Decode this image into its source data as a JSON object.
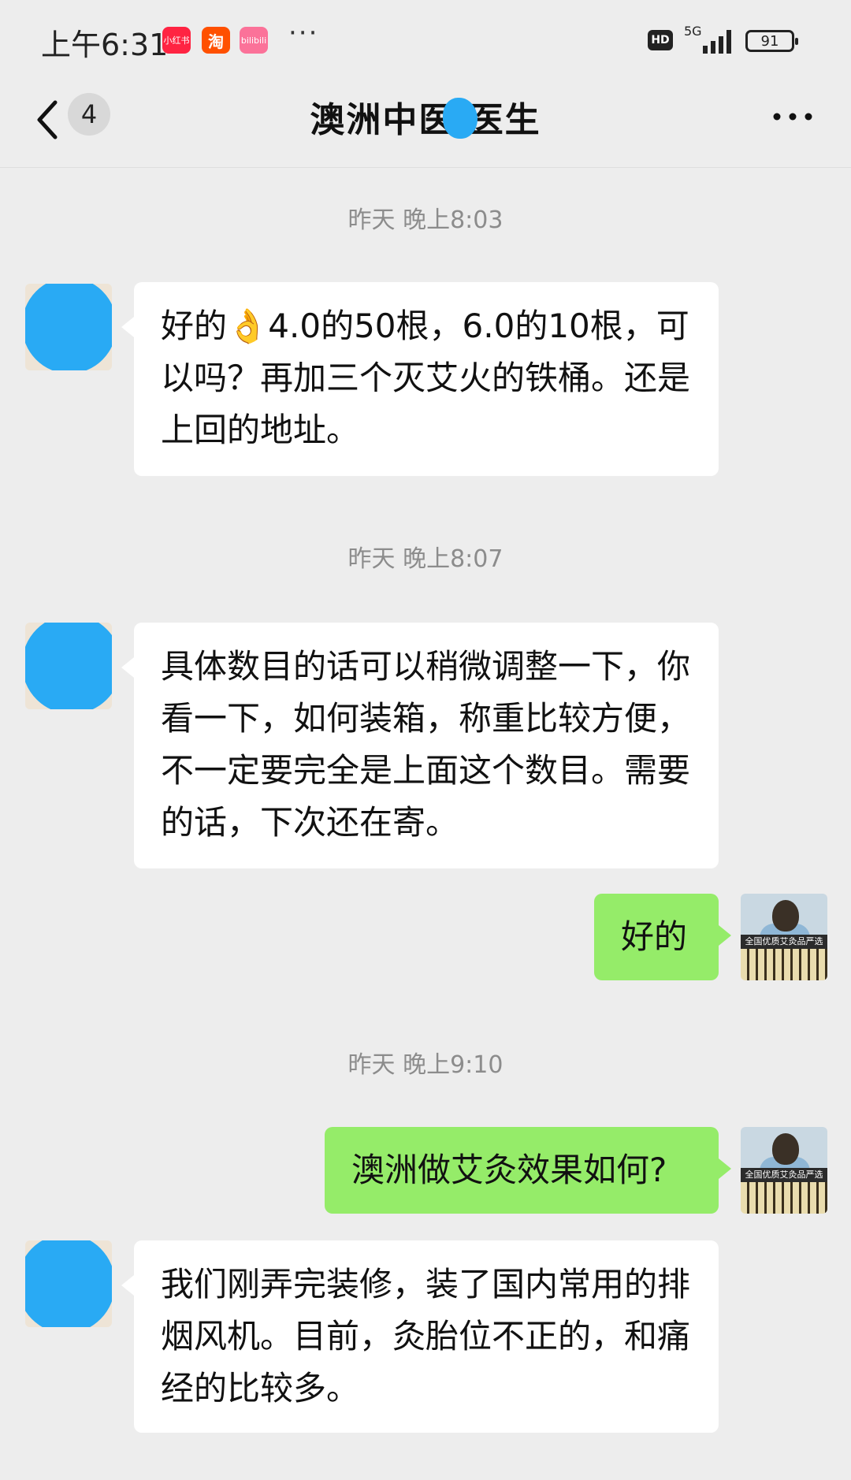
{
  "status_bar": {
    "time": "上午6:31",
    "apps": [
      {
        "name": "小红书",
        "color": "#ff2442"
      },
      {
        "name": "淘",
        "color": "#ff5000"
      },
      {
        "name": "bilibili",
        "color": "#fb7299"
      }
    ],
    "more": "···",
    "hd": "HD",
    "network": "5G",
    "battery": "91"
  },
  "nav": {
    "back_count": "4",
    "title": "澳洲中医 医生",
    "more_icon": "ellipsis-icon"
  },
  "avatar_caption": "全国优质艾灸品严选",
  "messages": [
    {
      "type": "time",
      "text": "昨天 晚上8:03"
    },
    {
      "type": "received",
      "text": "好的👌4.0的50根，6.0的10根，可以吗？再加三个灭艾火的铁桶。还是上回的地址。"
    },
    {
      "type": "time",
      "text": "昨天 晚上8:07"
    },
    {
      "type": "received",
      "text": "具体数目的话可以稍微调整一下，你看一下，如何装箱，称重比较方便，不一定要完全是上面这个数目。需要的话，下次还在寄。"
    },
    {
      "type": "sent",
      "text": "好的"
    },
    {
      "type": "time",
      "text": "昨天 晚上9:10"
    },
    {
      "type": "sent",
      "text": "澳洲做艾灸效果如何?"
    },
    {
      "type": "received",
      "text": "我们刚弄完装修，装了国内常用的排烟风机。目前，灸胎位不正的，和痛经的比较多。"
    }
  ],
  "colors": {
    "background": "#ededed",
    "sent_bubble": "#95ec69",
    "received_bubble": "#ffffff",
    "timestamp_text": "#8c8c8c",
    "redaction": "#29aaf4"
  }
}
